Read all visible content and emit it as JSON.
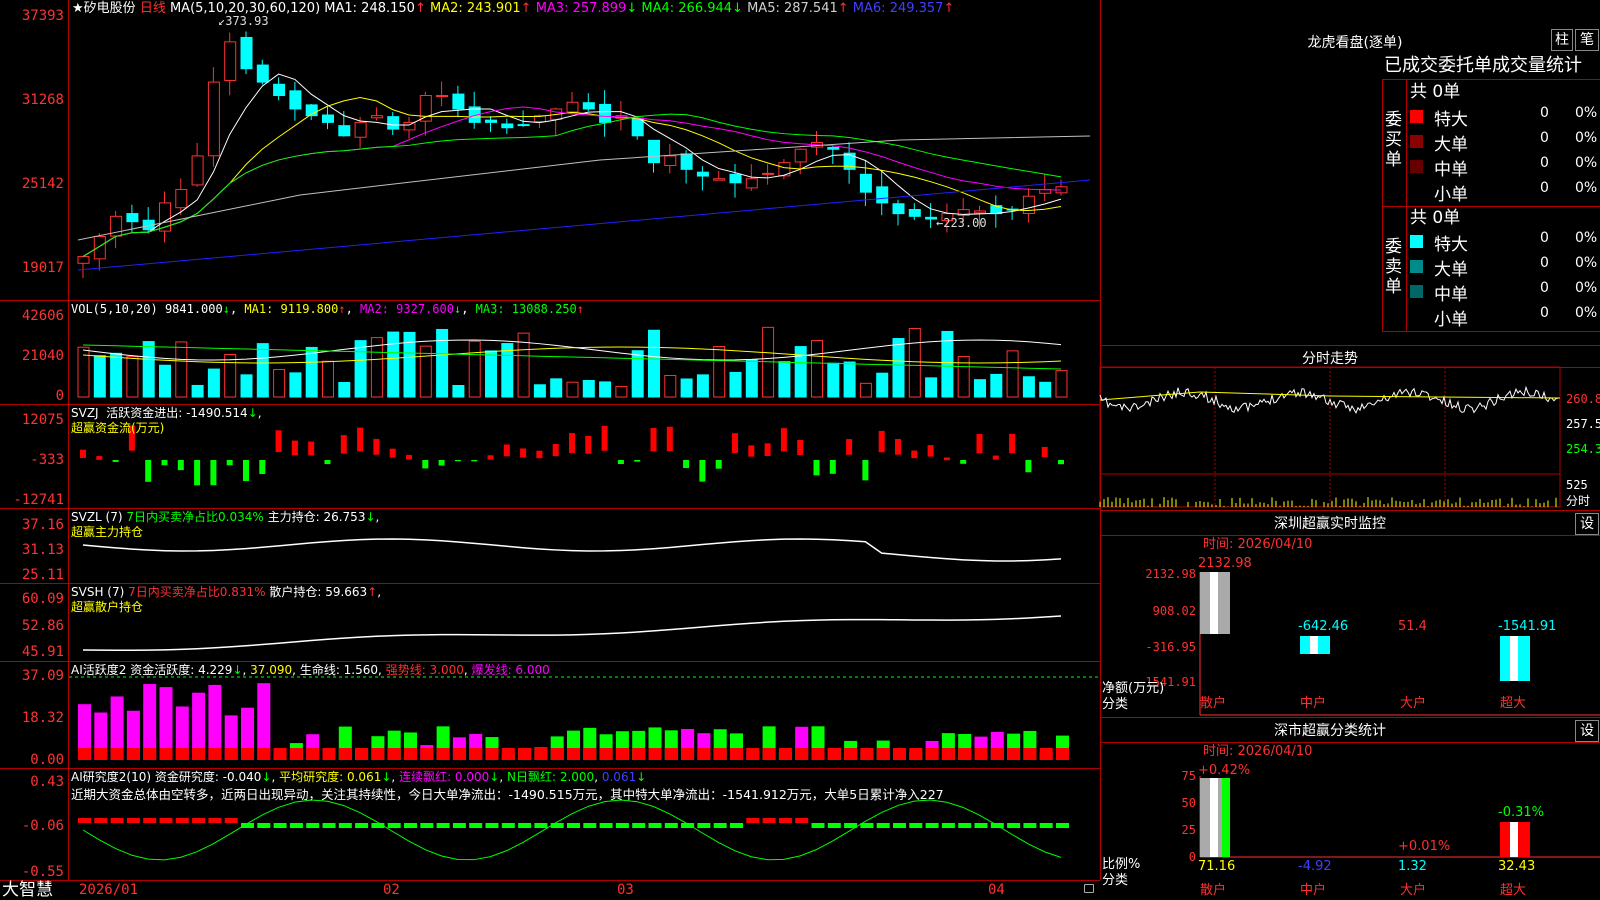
{
  "stock": {
    "star": "★",
    "name": "矽电股份",
    "period": "日线"
  },
  "ma": {
    "prefix": "MA(5,10,20,30,60,120)",
    "items": [
      {
        "label": "MA1: 248.150",
        "arrow": "↑",
        "color": "#ffffff"
      },
      {
        "label": "MA2: 243.901",
        "arrow": "↑",
        "color": "#ffff00"
      },
      {
        "label": "MA3: 257.899",
        "arrow": "↓",
        "color": "#ff00ff"
      },
      {
        "label": "MA4: 266.944",
        "arrow": "↓",
        "color": "#00ff00"
      },
      {
        "label": "MA5: 287.541",
        "arrow": "↑",
        "color": "#c0c0c0"
      },
      {
        "label": "MA6: 249.357",
        "arrow": "↑",
        "color": "#4040ff"
      }
    ],
    "high": "373.93",
    "low": "223.00"
  },
  "main_axis": [
    "37393",
    "31268",
    "25142",
    "19017"
  ],
  "vol": {
    "title": "VOL(5,10,20)",
    "value": "9841.000",
    "arrow": "↓",
    "ma1": "MA1: 9119.800",
    "ma1_arrow": "↑",
    "ma2": "MA2: 9327.600",
    "ma2_arrow": "↓",
    "ma3": "MA3: 13088.250",
    "ma3_arrow": "↑",
    "axis": [
      "42606",
      "21040",
      "0"
    ]
  },
  "svzj": {
    "title": "SVZJ",
    "label": "活跃资金进出: -1490.514",
    "arrow": "↓",
    "sep": ",",
    "sub": "超赢资金流(万元)",
    "axis": [
      "12075",
      "-333",
      "-12741"
    ]
  },
  "svzl": {
    "title": "SVZL (7)",
    "label7": "7日内买卖净占比0.034%",
    "label2": "主力持仓: 26.753",
    "arrow": "↓",
    "sep": ",",
    "sub": "超赢主力持仓",
    "axis": [
      "37.16",
      "31.13",
      "25.11"
    ]
  },
  "svsh": {
    "title": "SVSH (7)",
    "label7": "7日内买卖净占比0.831%",
    "label2": "散户持仓: 59.663",
    "arrow": "↑",
    "sep": ",",
    "sub": "超赢散户持仓",
    "axis": [
      "60.09",
      "52.86",
      "45.91"
    ]
  },
  "ai2": {
    "title": "AI活跃度2",
    "l1": "资金活跃度: 4.229",
    "a1": "↓",
    "sep": ",",
    "l2": "37.090",
    "l3": "生命线: 1.560",
    "l4": "强势线: 3.000",
    "l5": "爆发线: 6.000",
    "axis": [
      "37.09",
      "18.32",
      "0.00"
    ]
  },
  "ai_research": {
    "title": "AI研究度2(10)",
    "l1": "资金研究度: -0.040",
    "a1": "↓",
    "sep": ",",
    "l2": "平均研究度: 0.061",
    "a2": "↓",
    "l3": "连续飘红: 0.000",
    "a3": "↓",
    "l4": "N日飘红: 2.000",
    "l5": "0.061",
    "a5": "↓",
    "summary": "近期大资金总体由空转多，近两日出现异动，关注其持续性，今日大单净流出：-1490.515万元，其中特大单净流出：-1541.912万元，大单5日累计净入227",
    "axis": [
      "0.43",
      "-0.06",
      "-0.55"
    ]
  },
  "xaxis": [
    "2026/01",
    "02",
    "03",
    "04"
  ],
  "brand": "大智慧",
  "dragon": {
    "title": "龙虎看盘(逐单)",
    "btn1": "柱",
    "btn2": "笔",
    "tabs": [
      "已成交",
      "委托单",
      "成交量统计"
    ],
    "buy": {
      "label": "委买单",
      "total": "共 0单",
      "rows": [
        {
          "name": "特大",
          "v": "0",
          "p": "0%",
          "color": "#ff0000"
        },
        {
          "name": "大单",
          "v": "0",
          "p": "0%",
          "color": "#8b0000"
        },
        {
          "name": "中单",
          "v": "0",
          "p": "0%",
          "color": "#660000"
        },
        {
          "name": "小单",
          "v": "0",
          "p": "0%",
          "color": "#000000"
        }
      ]
    },
    "sell": {
      "label": "委卖单",
      "total": "共 0单",
      "rows": [
        {
          "name": "特大",
          "v": "0",
          "p": "0%",
          "color": "#00ffff"
        },
        {
          "name": "大单",
          "v": "0",
          "p": "0%",
          "color": "#008b8b"
        },
        {
          "name": "中单",
          "v": "0",
          "p": "0%",
          "color": "#006666"
        },
        {
          "name": "小单",
          "v": "0",
          "p": "0%",
          "color": "#000000"
        }
      ]
    }
  },
  "minute": {
    "title": "分时走势",
    "axis": [
      "260.8",
      "257.5",
      "254.3"
    ],
    "vol": "525",
    "vol_label": "分时"
  },
  "monitor": {
    "title": "深圳超赢实时监控",
    "btn": "设",
    "time": "时间: 2026/04/10",
    "axis": [
      "2132.98",
      "908.02",
      "-316.95",
      "-1541.91"
    ],
    "ylabel": "净额(万元)",
    "xlabel": "分类",
    "values": [
      "2132.98",
      "-642.46",
      "51.4",
      "-1541.91"
    ],
    "cats": [
      "散户",
      "中户",
      "大户",
      "超大"
    ]
  },
  "classify": {
    "title": "深市超赢分类统计",
    "btn": "设",
    "time": "时间: 2026/04/10",
    "axis": [
      "75",
      "50",
      "25",
      "0"
    ],
    "ylabel": "比例%",
    "xlabel": "分类",
    "top": [
      "+0.42%",
      "",
      "+0.01%",
      "-0.31%"
    ],
    "bottom": [
      "71.16",
      "-4.92",
      "1.32",
      "32.43"
    ],
    "cats": [
      "散户",
      "中户",
      "大户",
      "超大"
    ]
  }
}
